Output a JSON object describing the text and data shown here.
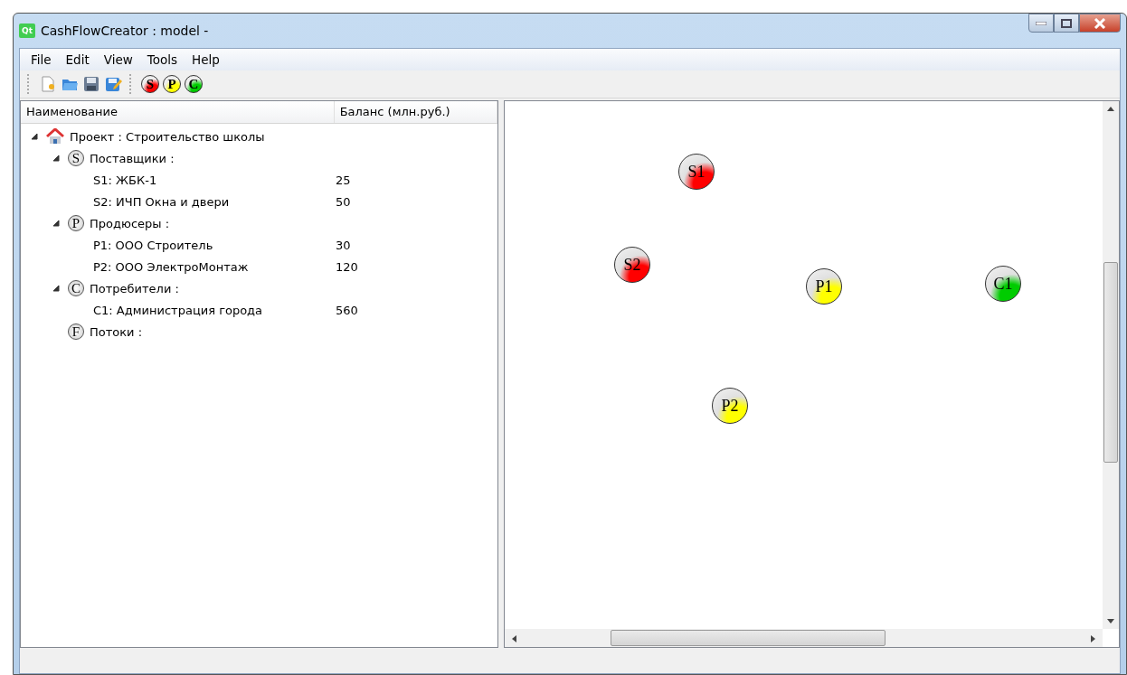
{
  "window": {
    "logo": "Qt",
    "title": "CashFlowCreator : model -"
  },
  "menu": [
    "File",
    "Edit",
    "View",
    "Tools",
    "Help"
  ],
  "toolbar": {
    "file_buttons": [
      {
        "kind": "new"
      },
      {
        "kind": "open"
      },
      {
        "kind": "save"
      },
      {
        "kind": "save_as"
      }
    ],
    "node_buttons": [
      {
        "letter": "S",
        "color": "#ff0000"
      },
      {
        "letter": "P",
        "color": "#ffff00"
      },
      {
        "letter": "C",
        "color": "#00cc00"
      }
    ]
  },
  "tree": {
    "columns": [
      "Наименование",
      "Баланс (млн.руб.)"
    ],
    "items": [
      {
        "kind": "project",
        "name": "Проект : Строительство школы",
        "expanded": true,
        "children": [
          {
            "kind": "group",
            "badge": "S",
            "name": "Поставщики :",
            "expanded": true,
            "children": [
              {
                "kind": "leaf",
                "name": "S1: ЖБК-1",
                "balance": "25"
              },
              {
                "kind": "leaf",
                "name": "S2: ИЧП Окна и двери",
                "balance": "50"
              }
            ]
          },
          {
            "kind": "group",
            "badge": "P",
            "name": "Продюсеры :",
            "expanded": true,
            "children": [
              {
                "kind": "leaf",
                "name": "P1: ООО Строитель",
                "balance": "30"
              },
              {
                "kind": "leaf",
                "name": "P2: ООО ЭлектроМонтаж",
                "balance": "120"
              }
            ]
          },
          {
            "kind": "group",
            "badge": "C",
            "name": "Потребители :",
            "expanded": true,
            "children": [
              {
                "kind": "leaf",
                "name": "C1: Администрация города",
                "balance": "560"
              }
            ]
          },
          {
            "kind": "group",
            "badge": "F",
            "name": "Потоки :",
            "expanded": false
          }
        ]
      }
    ]
  },
  "canvas": {
    "nodes": [
      {
        "label": "S1",
        "color": "#ff0000"
      },
      {
        "label": "S2",
        "color": "#ff0000"
      },
      {
        "label": "P1",
        "color": "#ffff00"
      },
      {
        "label": "C1",
        "color": "#00cc00"
      },
      {
        "label": "P2",
        "color": "#ffff00"
      }
    ]
  }
}
